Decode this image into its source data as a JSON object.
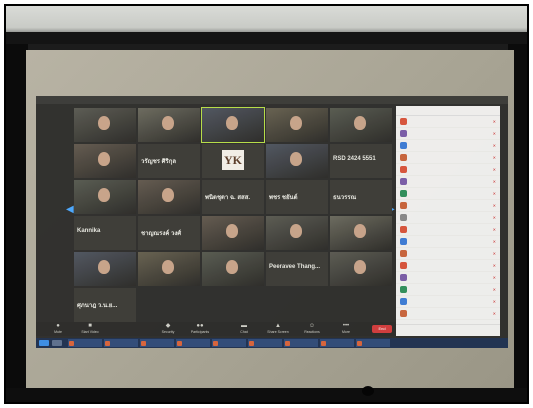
{
  "toolbar": {
    "items": [
      {
        "label": "Mute",
        "icon": "microphone-icon"
      },
      {
        "label": "Start Video",
        "icon": "video-camera-icon"
      },
      {
        "label": "Security",
        "icon": "shield-icon"
      },
      {
        "label": "Participants",
        "icon": "participants-icon"
      },
      {
        "label": "Chat",
        "icon": "chat-icon"
      },
      {
        "label": "Share Screen",
        "icon": "share-screen-icon"
      },
      {
        "label": "Reactions",
        "icon": "emoji-icon"
      },
      {
        "label": "More",
        "icon": "more-icon"
      }
    ],
    "end_label": "End"
  },
  "gallery": {
    "tiles": [
      {
        "name": "",
        "kind": "video"
      },
      {
        "name": "",
        "kind": "video"
      },
      {
        "name": "",
        "kind": "video",
        "active": true
      },
      {
        "name": "",
        "kind": "video"
      },
      {
        "name": "",
        "kind": "video"
      },
      {
        "name": "",
        "kind": "video"
      },
      {
        "name": "",
        "kind": "text",
        "big": "วรัญชร ศิริกุล"
      },
      {
        "name": "",
        "kind": "logo",
        "logo": "YK"
      },
      {
        "name": "",
        "kind": "video"
      },
      {
        "name": "",
        "kind": "text",
        "big": "RSD 2424 5551"
      },
      {
        "name": "",
        "kind": "video"
      },
      {
        "name": "",
        "kind": "video"
      },
      {
        "name": "",
        "kind": "text",
        "big": "พนิตชุดา ฉ. สสส."
      },
      {
        "name": "",
        "kind": "text",
        "big": "พชร ชยันต์"
      },
      {
        "name": "",
        "kind": "text",
        "big": "ธนวรรณ"
      },
      {
        "name": "",
        "kind": "text",
        "big": "Kannika"
      },
      {
        "name": "",
        "kind": "text",
        "big": "ชาญณรงค์ วงศ์"
      },
      {
        "name": "",
        "kind": "video"
      },
      {
        "name": "",
        "kind": "video"
      },
      {
        "name": "",
        "kind": "video"
      },
      {
        "name": "",
        "kind": "video"
      },
      {
        "name": "",
        "kind": "video"
      },
      {
        "name": "",
        "kind": "video"
      },
      {
        "name": "",
        "kind": "text",
        "big": "Peeravee Thang..."
      },
      {
        "name": "",
        "kind": "video"
      },
      {
        "name": "",
        "kind": "text",
        "big": "ศุภนาฎ ว.น.ย..."
      }
    ]
  },
  "participants": {
    "header": "",
    "rows": [
      {
        "name": "",
        "color": "#d9533a"
      },
      {
        "name": "",
        "color": "#7a5ca8"
      },
      {
        "name": "",
        "color": "#3b7bd6"
      },
      {
        "name": "",
        "color": "#c9633a"
      },
      {
        "name": "",
        "color": "#d9533a"
      },
      {
        "name": "",
        "color": "#7a5ca8"
      },
      {
        "name": "",
        "color": "#2f8f5a"
      },
      {
        "name": "",
        "color": "#c9633a"
      },
      {
        "name": "",
        "color": "#888888"
      },
      {
        "name": "",
        "color": "#d9533a"
      },
      {
        "name": "",
        "color": "#3b7bd6"
      },
      {
        "name": "",
        "color": "#c9633a"
      },
      {
        "name": "",
        "color": "#d9533a"
      },
      {
        "name": "",
        "color": "#7a5ca8"
      },
      {
        "name": "",
        "color": "#2f8f5a"
      },
      {
        "name": "",
        "color": "#3b7bd6"
      },
      {
        "name": "",
        "color": "#c9633a"
      }
    ],
    "footer": [
      "",
      ""
    ]
  },
  "taskbar": {
    "apps": [
      "",
      "",
      "",
      "",
      "",
      "",
      "",
      "",
      ""
    ],
    "tray_time": "",
    "tray_date": ""
  },
  "colors": {
    "accent_green": "#b8e046",
    "end_red": "#d23b3b",
    "taskbar_blue": "#1e3050"
  }
}
